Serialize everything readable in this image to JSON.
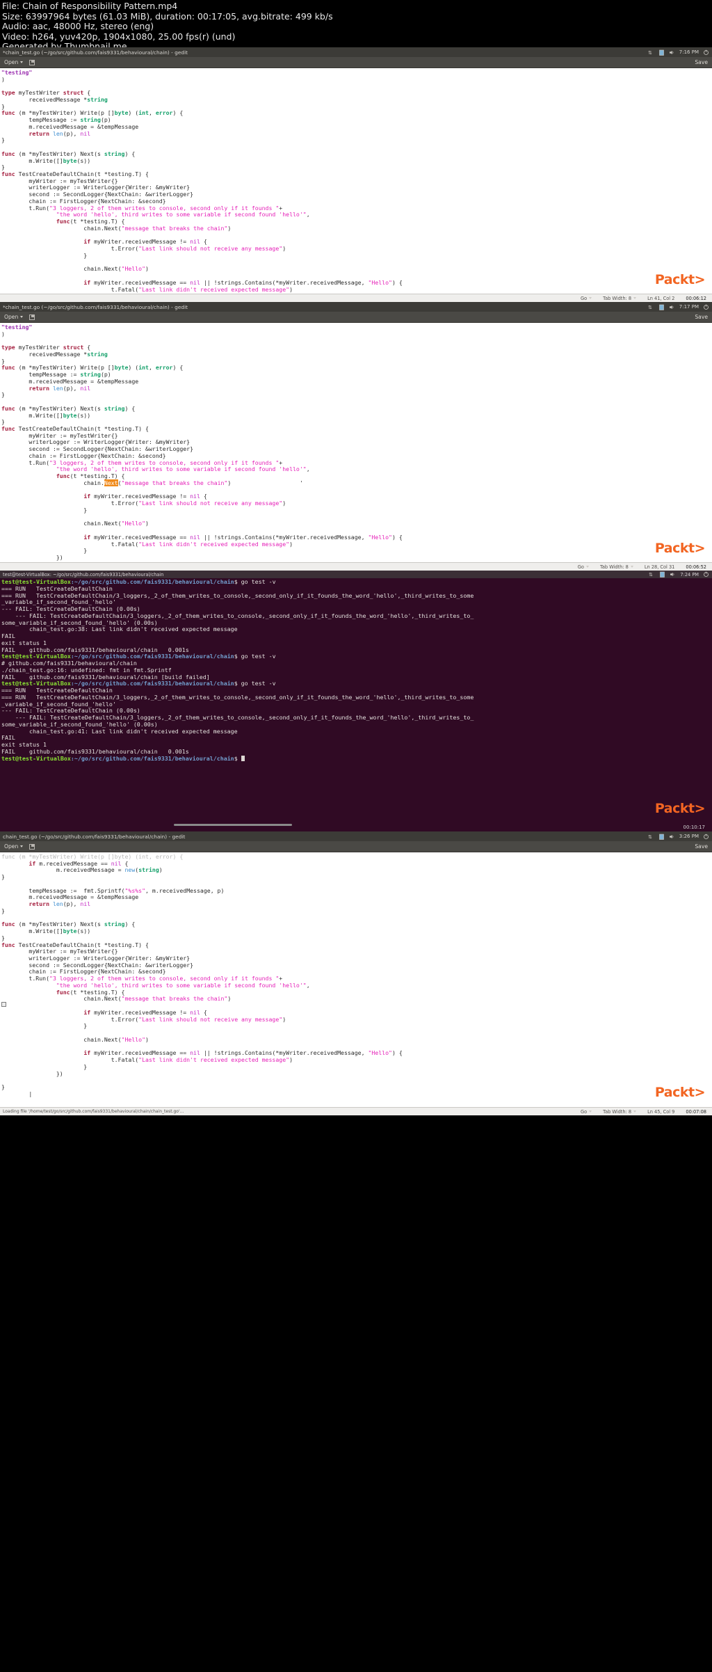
{
  "video_info": {
    "lines": [
      "File: Chain of Responsibility Pattern.mp4",
      "Size: 63997964 bytes (61.03 MiB), duration: 00:17:05, avg.bitrate: 499 kb/s",
      "Audio: aac, 48000 Hz, stereo (eng)",
      "Video: h264, yuv420p, 1904x1080, 25.00 fps(r) (und)",
      "Generated by Thumbnail me"
    ]
  },
  "editor1": {
    "title": "*chain_test.go (~/go/src/github.com/fais9331/behavioural/chain) - gedit",
    "clock": "7:16 PM",
    "open_label": "Open",
    "save_label": "Save",
    "status": {
      "lang": "Go",
      "tab_width": "Tab Width: 8",
      "position": "Ln 41, Col 2"
    },
    "watermark": "Packt",
    "timestamp": "00:06:12"
  },
  "editor2": {
    "title": "*chain_test.go (~/go/src/github.com/fais9331/behavioural/chain) - gedit",
    "clock": "7:17 PM",
    "open_label": "Open",
    "save_label": "Save",
    "status": {
      "lang": "Go",
      "tab_width": "Tab Width: 8",
      "position": "Ln 28, Col 31"
    },
    "watermark": "Packt",
    "timestamp": "00:06:52"
  },
  "editor3": {
    "title": "chain_test.go (~/go/src/github.com/fais9331/behavioural/chain) - gedit",
    "clock": "3:26 PM",
    "open_label": "Open",
    "save_label": "Save",
    "status": {
      "lang": "Go",
      "tab_width": "Tab Width: 8",
      "position": "Ln 45, Col 9"
    },
    "loading": "Loading file '/home/test/go/src/github.com/fais9331/behavioural/chain/chain_test.go'...",
    "watermark": "Packt",
    "timestamp": "00:07:08"
  },
  "terminal": {
    "title": "test@test-VirtualBox: ~/go/src/github.com/fais9331/behavioural/chain",
    "clock": "7:24 PM",
    "prompt_user": "test@test-VirtualBox",
    "prompt_path": ":~/go/src/github.com/fais9331/behavioural/chain",
    "watermark": "Packt",
    "timestamp": "00:10:17",
    "lines": [
      {
        "type": "prompt",
        "cmd": "$ go test -v"
      },
      {
        "type": "out",
        "text": "=== RUN   TestCreateDefaultChain"
      },
      {
        "type": "out",
        "text": "=== RUN   TestCreateDefaultChain/3_loggers,_2_of_them_writes_to_console,_second_only_if_it_founds_the_word_'hello',_third_writes_to_some"
      },
      {
        "type": "out",
        "text": "_variable_if_second_found_'hello'"
      },
      {
        "type": "out",
        "text": "--- FAIL: TestCreateDefaultChain (0.00s)"
      },
      {
        "type": "out",
        "text": "    --- FAIL: TestCreateDefaultChain/3_loggers,_2_of_them_writes_to_console,_second_only_if_it_founds_the_word_'hello',_third_writes_to_"
      },
      {
        "type": "out",
        "text": "some_variable_if_second_found_'hello' (0.00s)"
      },
      {
        "type": "out",
        "text": "        chain_test.go:38: Last link didn't received expected message"
      },
      {
        "type": "out",
        "text": "FAIL"
      },
      {
        "type": "out",
        "text": "exit status 1"
      },
      {
        "type": "out",
        "text": "FAIL    github.com/fais9331/behavioural/chain   0.001s"
      },
      {
        "type": "prompt",
        "cmd": "$ go test -v"
      },
      {
        "type": "out",
        "text": "# github.com/fais9331/behavioural/chain"
      },
      {
        "type": "out",
        "text": "./chain_test.go:16: undefined: fmt in fmt.Sprintf"
      },
      {
        "type": "out",
        "text": "FAIL    github.com/fais9331/behavioural/chain [build failed]"
      },
      {
        "type": "prompt",
        "cmd": "$ go test -v"
      },
      {
        "type": "out",
        "text": "=== RUN   TestCreateDefaultChain"
      },
      {
        "type": "out",
        "text": "=== RUN   TestCreateDefaultChain/3_loggers,_2_of_them_writes_to_console,_second_only_if_it_founds_the_word_'hello',_third_writes_to_some"
      },
      {
        "type": "out",
        "text": "_variable_if_second_found_'hello'"
      },
      {
        "type": "out",
        "text": "--- FAIL: TestCreateDefaultChain (0.00s)"
      },
      {
        "type": "out",
        "text": "    --- FAIL: TestCreateDefaultChain/3_loggers,_2_of_them_writes_to_console,_second_only_if_it_founds_the_word_'hello',_third_writes_to_"
      },
      {
        "type": "out",
        "text": "some_variable_if_second_found_'hello' (0.00s)"
      },
      {
        "type": "out",
        "text": "        chain_test.go:41: Last link didn't received expected message"
      },
      {
        "type": "out",
        "text": "FAIL"
      },
      {
        "type": "out",
        "text": "exit status 1"
      },
      {
        "type": "out",
        "text": "FAIL    github.com/fais9331/behavioural/chain   0.001s"
      },
      {
        "type": "prompt-cursor",
        "cmd": "$ "
      }
    ]
  },
  "colors": {
    "keyword": "#a52040",
    "type": "#14a06a",
    "string": "#e520b8",
    "builtin": "#3f8fd0",
    "nil": "#c428c4",
    "terminal_bg": "#300a24",
    "prompt_user": "#8ae234",
    "prompt_path": "#729fcf",
    "accent": "#f26522",
    "selection": "#f08a1a"
  }
}
